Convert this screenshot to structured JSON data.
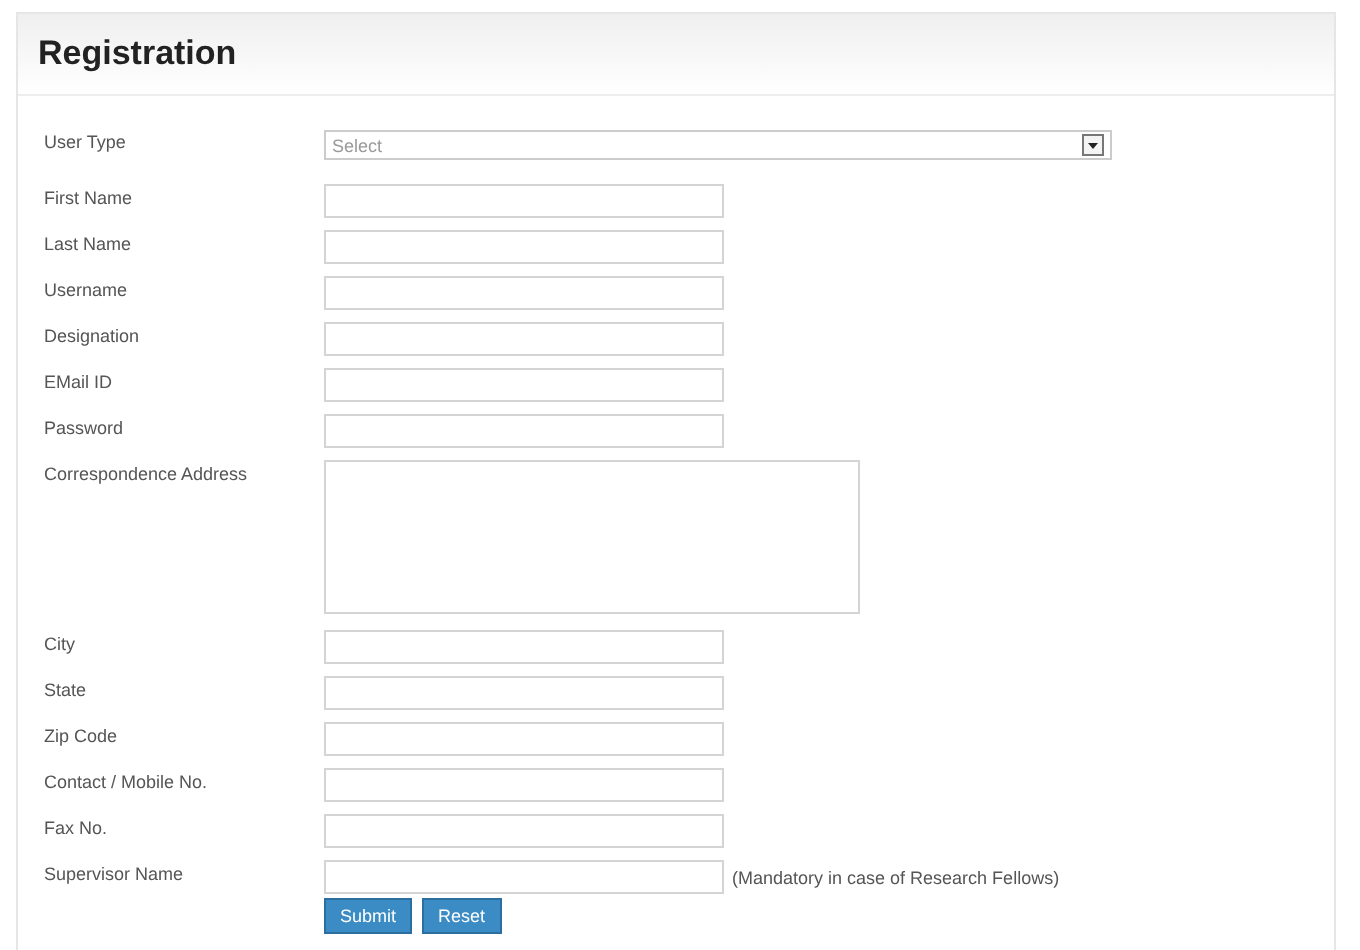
{
  "title": "Registration",
  "fields": [
    {
      "label": "User Type",
      "kind": "select",
      "value": "Select"
    },
    {
      "label": "First Name",
      "kind": "text"
    },
    {
      "label": "Last Name",
      "kind": "text"
    },
    {
      "label": "Username",
      "kind": "text"
    },
    {
      "label": "Designation",
      "kind": "text"
    },
    {
      "label": "EMail ID",
      "kind": "text"
    },
    {
      "label": "Password",
      "kind": "text"
    },
    {
      "label": "Correspondence Address",
      "kind": "textarea"
    },
    {
      "label": "City",
      "kind": "text"
    },
    {
      "label": "State",
      "kind": "text"
    },
    {
      "label": "Zip Code",
      "kind": "text"
    },
    {
      "label": "Contact / Mobile No.",
      "kind": "text"
    },
    {
      "label": "Fax No.",
      "kind": "text"
    },
    {
      "label": "Supervisor Name",
      "kind": "text",
      "note": "(Mandatory in case of Research Fellows)"
    }
  ],
  "buttons": [
    "Submit",
    "Reset"
  ]
}
